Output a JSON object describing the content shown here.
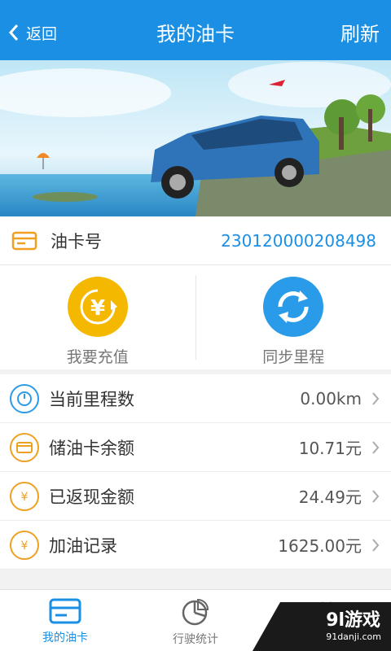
{
  "header": {
    "back_label": "返回",
    "title": "我的油卡",
    "refresh_label": "刷新"
  },
  "card": {
    "label": "油卡号",
    "number": "23012000020849​8"
  },
  "actions": [
    {
      "label": "我要充值",
      "icon": "yen-refresh-icon",
      "color": "#f5b800"
    },
    {
      "label": "同步里程",
      "icon": "sync-icon",
      "color": "#2a9be8"
    }
  ],
  "list": [
    {
      "label": "当前里程数",
      "value": "0.00km",
      "icon": "odometer-icon",
      "color": "#2a9be8"
    },
    {
      "label": "储油卡余额",
      "value": "10.71元",
      "icon": "card-icon",
      "color": "#f0a020"
    },
    {
      "label": "已返现金额",
      "value": "24.49元",
      "icon": "yen-cashback-icon",
      "color": "#f0a020"
    },
    {
      "label": "加油记录",
      "value": "1625.00元",
      "icon": "yen-record-icon",
      "color": "#f0a020"
    }
  ],
  "tabs": [
    {
      "label": "我的油卡",
      "icon": "card-tab-icon",
      "active": true
    },
    {
      "label": "行驶统计",
      "icon": "pie-chart-icon",
      "active": false
    },
    {
      "label": "",
      "icon": "more-icon",
      "active": false
    }
  ],
  "watermark": {
    "brand": "9l游戏",
    "url": "91danji.com"
  },
  "colors": {
    "header": "#1a8fe3",
    "accent": "#1a8fe3"
  }
}
